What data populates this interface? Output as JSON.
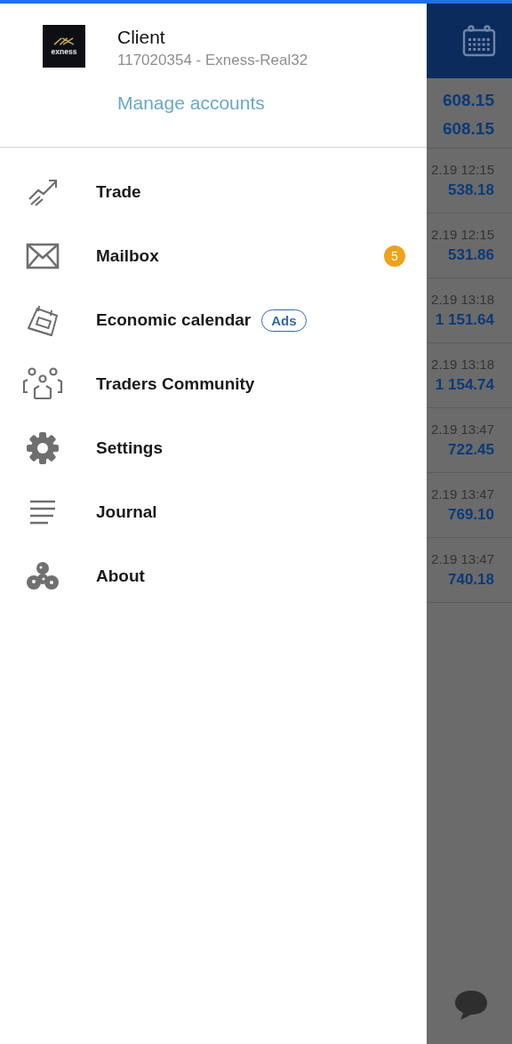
{
  "account": {
    "logo_text": "exness",
    "name": "Client",
    "details": "117020354 - Exness-Real32",
    "manage_link": "Manage accounts"
  },
  "menu": [
    {
      "label": "Trade"
    },
    {
      "label": "Mailbox",
      "badge": "5"
    },
    {
      "label": "Economic calendar",
      "tag": "Ads"
    },
    {
      "label": "Traders Community"
    },
    {
      "label": "Settings"
    },
    {
      "label": "Journal"
    },
    {
      "label": "About"
    }
  ],
  "background": {
    "balances": [
      "608.15",
      "608.15"
    ],
    "rows": [
      {
        "time": "2.19 12:15",
        "value": "538.18"
      },
      {
        "time": "2.19 12:15",
        "value": "531.86"
      },
      {
        "time": "2.19 13:18",
        "value": "1 151.64"
      },
      {
        "time": "2.19 13:18",
        "value": "1 154.74"
      },
      {
        "time": "2.19 13:47",
        "value": "722.45"
      },
      {
        "time": "2.19 13:47",
        "value": "769.10"
      },
      {
        "time": "2.19 13:47",
        "value": "740.18"
      }
    ]
  }
}
